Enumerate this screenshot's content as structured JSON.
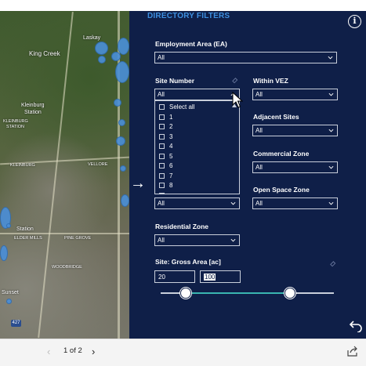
{
  "map": {
    "labels": [
      "Laskay",
      "King Creek",
      "Kleinburg",
      "Station",
      "KLEINBURG",
      "STATION",
      "KLEINBURG",
      "VELLORE",
      "Station",
      "ELDER MILLS",
      "PINE GROVE",
      "WOODBRIDGE",
      "Sunset",
      "427"
    ],
    "bubble_color": "#4a8fd9"
  },
  "panel": {
    "title": "DIRECTORY FILTERS",
    "info_icon": "info-icon",
    "bg_color": "#0f1f48",
    "title_color": "#3d8fe0",
    "filters": {
      "employment_area": {
        "label": "Employment Area (EA)",
        "value": "All"
      },
      "site_number": {
        "label": "Site Number",
        "value": "All"
      },
      "within_vez": {
        "label": "Within VEZ",
        "value": "All"
      },
      "adjacent_sites": {
        "label": "Adjacent Sites",
        "value": "All"
      },
      "commercial_zone": {
        "label": "Commercial Zone",
        "value": "All"
      },
      "hidden_filter": {
        "value": "All"
      },
      "open_space_zone": {
        "label": "Open Space Zone",
        "value": "All"
      },
      "residential_zone": {
        "label": "Residential Zone",
        "value": "All"
      }
    },
    "site_number_options": [
      "Select all",
      "1",
      "2",
      "3",
      "4",
      "5",
      "6",
      "7",
      "8"
    ],
    "gross_area": {
      "label": "Site: Gross Area [ac]",
      "min": "20",
      "max": "100",
      "slider_color": "#3ab5b0"
    }
  },
  "bottom_bar": {
    "page_indicator": "1 of 2",
    "prev_icon": "chevron-left-icon",
    "next_icon": "chevron-right-icon",
    "share_icon": "share-icon"
  }
}
